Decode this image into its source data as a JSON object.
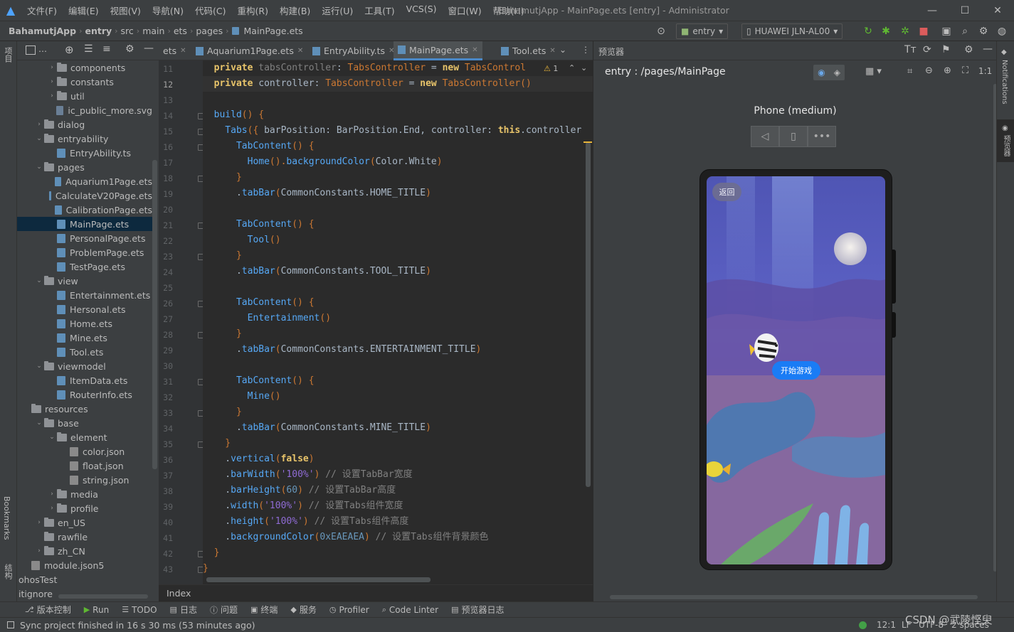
{
  "menubar": {
    "items": [
      "文件(F)",
      "编辑(E)",
      "视图(V)",
      "导航(N)",
      "代码(C)",
      "重构(R)",
      "构建(B)",
      "运行(U)",
      "工具(T)",
      "VCS(S)",
      "窗口(W)",
      "帮助(H)"
    ],
    "window_title": "BahamutjApp - MainPage.ets [entry] - Administrator"
  },
  "breadcrumb": [
    "BahamutjApp",
    "entry",
    "src",
    "main",
    "ets",
    "pages",
    "MainPage.ets"
  ],
  "toolbar": {
    "module": "entry",
    "device": "HUAWEI JLN-AL00"
  },
  "left_strip": {
    "project": "项目",
    "bookmarks": "Bookmarks",
    "structure": "结构"
  },
  "right_strip": {
    "notifications": "Notifications",
    "previewer": "预览器"
  },
  "project_tree": [
    {
      "label": "components",
      "type": "folder",
      "depth": 2,
      "arrow": "›"
    },
    {
      "label": "constants",
      "type": "folder",
      "depth": 2,
      "arrow": "›"
    },
    {
      "label": "util",
      "type": "folder",
      "depth": 2,
      "arrow": "›"
    },
    {
      "label": "ic_public_more.svg",
      "type": "svg",
      "depth": 2,
      "arrow": ""
    },
    {
      "label": "dialog",
      "type": "folder",
      "depth": 1,
      "arrow": "›"
    },
    {
      "label": "entryability",
      "type": "folder",
      "depth": 1,
      "arrow": "⌄"
    },
    {
      "label": "EntryAbility.ts",
      "type": "file",
      "depth": 2,
      "arrow": ""
    },
    {
      "label": "pages",
      "type": "folder",
      "depth": 1,
      "arrow": "⌄"
    },
    {
      "label": "Aquarium1Page.ets",
      "type": "file",
      "depth": 2,
      "arrow": ""
    },
    {
      "label": "CalculateV20Page.ets",
      "type": "file",
      "depth": 2,
      "arrow": ""
    },
    {
      "label": "CalibrationPage.ets",
      "type": "file",
      "depth": 2,
      "arrow": ""
    },
    {
      "label": "MainPage.ets",
      "type": "file",
      "depth": 2,
      "arrow": "",
      "selected": true
    },
    {
      "label": "PersonalPage.ets",
      "type": "file",
      "depth": 2,
      "arrow": ""
    },
    {
      "label": "ProblemPage.ets",
      "type": "file",
      "depth": 2,
      "arrow": ""
    },
    {
      "label": "TestPage.ets",
      "type": "file",
      "depth": 2,
      "arrow": ""
    },
    {
      "label": "view",
      "type": "folder",
      "depth": 1,
      "arrow": "⌄"
    },
    {
      "label": "Entertainment.ets",
      "type": "file",
      "depth": 2,
      "arrow": ""
    },
    {
      "label": "Hersonal.ets",
      "type": "file",
      "depth": 2,
      "arrow": ""
    },
    {
      "label": "Home.ets",
      "type": "file",
      "depth": 2,
      "arrow": ""
    },
    {
      "label": "Mine.ets",
      "type": "file",
      "depth": 2,
      "arrow": ""
    },
    {
      "label": "Tool.ets",
      "type": "file",
      "depth": 2,
      "arrow": ""
    },
    {
      "label": "viewmodel",
      "type": "folder",
      "depth": 1,
      "arrow": "⌄"
    },
    {
      "label": "ItemData.ets",
      "type": "file",
      "depth": 2,
      "arrow": ""
    },
    {
      "label": "RouterInfo.ets",
      "type": "file",
      "depth": 2,
      "arrow": ""
    },
    {
      "label": "resources",
      "type": "folder",
      "depth": 0,
      "arrow": ""
    },
    {
      "label": "base",
      "type": "folder",
      "depth": 1,
      "arrow": "⌄"
    },
    {
      "label": "element",
      "type": "folder",
      "depth": 2,
      "arrow": "⌄"
    },
    {
      "label": "color.json",
      "type": "json",
      "depth": 3,
      "arrow": ""
    },
    {
      "label": "float.json",
      "type": "json",
      "depth": 3,
      "arrow": ""
    },
    {
      "label": "string.json",
      "type": "json",
      "depth": 3,
      "arrow": ""
    },
    {
      "label": "media",
      "type": "folder",
      "depth": 2,
      "arrow": "›"
    },
    {
      "label": "profile",
      "type": "folder",
      "depth": 2,
      "arrow": "›"
    },
    {
      "label": "en_US",
      "type": "folder",
      "depth": 1,
      "arrow": "›"
    },
    {
      "label": "rawfile",
      "type": "folder",
      "depth": 1,
      "arrow": ""
    },
    {
      "label": "zh_CN",
      "type": "folder",
      "depth": 1,
      "arrow": "›"
    },
    {
      "label": "module.json5",
      "type": "json",
      "depth": 0,
      "arrow": ""
    },
    {
      "label": "ohosTest",
      "type": "plain",
      "depth": -1,
      "arrow": ""
    },
    {
      "label": "itignore",
      "type": "plain",
      "depth": -1,
      "arrow": ""
    }
  ],
  "editor_tabs": [
    {
      "label": "ets"
    },
    {
      "label": "Aquarium1Page.ets"
    },
    {
      "label": "EntryAbility.ts"
    },
    {
      "label": "MainPage.ets",
      "active": true
    },
    {
      "label": "Tool.ets"
    }
  ],
  "editor": {
    "line_numbers": [
      "11",
      "12",
      "13",
      "14",
      "15",
      "16",
      "17",
      "18",
      "19",
      "20",
      "21",
      "22",
      "23",
      "24",
      "25",
      "26",
      "27",
      "28",
      "29",
      "30",
      "31",
      "32",
      "33",
      "34",
      "35",
      "36",
      "37",
      "38",
      "39",
      "40",
      "41",
      "42",
      "43"
    ],
    "warning_count": "1",
    "footer_label": "Index",
    "lines": [
      [
        {
          "t": "  private ",
          "c": "kwy"
        },
        {
          "t": "tabsController",
          "c": "cm"
        },
        {
          "t": ": ",
          "c": "pl"
        },
        {
          "t": "TabsController",
          "c": "ty"
        },
        {
          "t": " = ",
          "c": "pl"
        },
        {
          "t": "new ",
          "c": "kwy"
        },
        {
          "t": "TabsControl",
          "c": "ty"
        }
      ],
      [
        {
          "t": "  private ",
          "c": "kwy"
        },
        {
          "t": "controller",
          "c": "pl"
        },
        {
          "t": ": ",
          "c": "pl"
        },
        {
          "t": "TabsController",
          "c": "ty"
        },
        {
          "t": " = ",
          "c": "pl"
        },
        {
          "t": "new ",
          "c": "kwy"
        },
        {
          "t": "TabsController",
          "c": "ty"
        },
        {
          "t": "()",
          "c": "ty"
        }
      ],
      [],
      [
        {
          "t": "  build",
          "c": "fn"
        },
        {
          "t": "() {",
          "c": "ty"
        }
      ],
      [
        {
          "t": "    Tabs",
          "c": "fn"
        },
        {
          "t": "({ ",
          "c": "ty"
        },
        {
          "t": "barPosition",
          "c": "pl"
        },
        {
          "t": ": BarPosition.End, ",
          "c": "pl"
        },
        {
          "t": "controller",
          "c": "pl"
        },
        {
          "t": ": ",
          "c": "pl"
        },
        {
          "t": "this",
          "c": "kwy"
        },
        {
          "t": ".controller",
          "c": "pl"
        }
      ],
      [
        {
          "t": "      TabContent",
          "c": "fn"
        },
        {
          "t": "() {",
          "c": "ty"
        }
      ],
      [
        {
          "t": "        Home",
          "c": "fn"
        },
        {
          "t": "().",
          "c": "ty"
        },
        {
          "t": "backgroundColor",
          "c": "fn"
        },
        {
          "t": "(",
          "c": "ty"
        },
        {
          "t": "Color.White",
          "c": "pl"
        },
        {
          "t": ")",
          "c": "ty"
        }
      ],
      [
        {
          "t": "      }",
          "c": "ty"
        }
      ],
      [
        {
          "t": "      .",
          "c": "pl"
        },
        {
          "t": "tabBar",
          "c": "fn"
        },
        {
          "t": "(",
          "c": "ty"
        },
        {
          "t": "CommonConstants.HOME_TITLE",
          "c": "pl"
        },
        {
          "t": ")",
          "c": "ty"
        }
      ],
      [],
      [
        {
          "t": "      TabContent",
          "c": "fn"
        },
        {
          "t": "() {",
          "c": "ty"
        }
      ],
      [
        {
          "t": "        Tool",
          "c": "fn"
        },
        {
          "t": "()",
          "c": "ty"
        }
      ],
      [
        {
          "t": "      }",
          "c": "ty"
        }
      ],
      [
        {
          "t": "      .",
          "c": "pl"
        },
        {
          "t": "tabBar",
          "c": "fn"
        },
        {
          "t": "(",
          "c": "ty"
        },
        {
          "t": "CommonConstants.TOOL_TITLE",
          "c": "pl"
        },
        {
          "t": ")",
          "c": "ty"
        }
      ],
      [],
      [
        {
          "t": "      TabContent",
          "c": "fn"
        },
        {
          "t": "() {",
          "c": "ty"
        }
      ],
      [
        {
          "t": "        Entertainment",
          "c": "fn"
        },
        {
          "t": "()",
          "c": "ty"
        }
      ],
      [
        {
          "t": "      }",
          "c": "ty"
        }
      ],
      [
        {
          "t": "      .",
          "c": "pl"
        },
        {
          "t": "tabBar",
          "c": "fn"
        },
        {
          "t": "(",
          "c": "ty"
        },
        {
          "t": "CommonConstants.ENTERTAINMENT_TITLE",
          "c": "pl"
        },
        {
          "t": ")",
          "c": "ty"
        }
      ],
      [],
      [
        {
          "t": "      TabContent",
          "c": "fn"
        },
        {
          "t": "() {",
          "c": "ty"
        }
      ],
      [
        {
          "t": "        Mine",
          "c": "fn"
        },
        {
          "t": "()",
          "c": "ty"
        }
      ],
      [
        {
          "t": "      }",
          "c": "ty"
        }
      ],
      [
        {
          "t": "      .",
          "c": "pl"
        },
        {
          "t": "tabBar",
          "c": "fn"
        },
        {
          "t": "(",
          "c": "ty"
        },
        {
          "t": "CommonConstants.MINE_TITLE",
          "c": "pl"
        },
        {
          "t": ")",
          "c": "ty"
        }
      ],
      [
        {
          "t": "    }",
          "c": "ty"
        }
      ],
      [
        {
          "t": "    .",
          "c": "pl"
        },
        {
          "t": "vertical",
          "c": "fn"
        },
        {
          "t": "(",
          "c": "ty"
        },
        {
          "t": "false",
          "c": "kwy"
        },
        {
          "t": ")",
          "c": "ty"
        }
      ],
      [
        {
          "t": "    .",
          "c": "pl"
        },
        {
          "t": "barWidth",
          "c": "fn"
        },
        {
          "t": "(",
          "c": "ty"
        },
        {
          "t": "'100%'",
          "c": "str"
        },
        {
          "t": ") ",
          "c": "ty"
        },
        {
          "t": "// 设置TabBar宽度",
          "c": "cm"
        }
      ],
      [
        {
          "t": "    .",
          "c": "pl"
        },
        {
          "t": "barHeight",
          "c": "fn"
        },
        {
          "t": "(",
          "c": "ty"
        },
        {
          "t": "60",
          "c": "num"
        },
        {
          "t": ") ",
          "c": "ty"
        },
        {
          "t": "// 设置TabBar高度",
          "c": "cm"
        }
      ],
      [
        {
          "t": "    .",
          "c": "pl"
        },
        {
          "t": "width",
          "c": "fn"
        },
        {
          "t": "(",
          "c": "ty"
        },
        {
          "t": "'100%'",
          "c": "str"
        },
        {
          "t": ") ",
          "c": "ty"
        },
        {
          "t": "// 设置Tabs组件宽度",
          "c": "cm"
        }
      ],
      [
        {
          "t": "    .",
          "c": "pl"
        },
        {
          "t": "height",
          "c": "fn"
        },
        {
          "t": "(",
          "c": "ty"
        },
        {
          "t": "'100%'",
          "c": "str"
        },
        {
          "t": ") ",
          "c": "ty"
        },
        {
          "t": "// 设置Tabs组件高度",
          "c": "cm"
        }
      ],
      [
        {
          "t": "    .",
          "c": "pl"
        },
        {
          "t": "backgroundColor",
          "c": "fn"
        },
        {
          "t": "(",
          "c": "ty"
        },
        {
          "t": "0xEAEAEA",
          "c": "num"
        },
        {
          "t": ") ",
          "c": "ty"
        },
        {
          "t": "// 设置Tabs组件背景颜色",
          "c": "cm"
        }
      ],
      [
        {
          "t": "  }",
          "c": "ty"
        }
      ],
      [
        {
          "t": "}",
          "c": "ty"
        }
      ]
    ]
  },
  "preview": {
    "title": "预览器",
    "route": "entry : /pages/MainPage",
    "device_name": "Phone (medium)",
    "phone": {
      "back_label": "返回",
      "start_game_label": "开始游戏"
    }
  },
  "bottom_tools": [
    "版本控制",
    "Run",
    "TODO",
    "日志",
    "问题",
    "终端",
    "服务",
    "Profiler",
    "Code Linter",
    "预览器日志"
  ],
  "status": {
    "message": "Sync project finished in 16 s 30 ms (53 minutes ago)",
    "position": "12:1",
    "line_sep": "LF",
    "encoding": "UTF-8",
    "indent": "2 spaces",
    "watermark": "CSDN @武陵悭臾"
  },
  "colors": {
    "accent": "#4a88c7",
    "selection": "#0d293e",
    "start_button": "#1a7cf5"
  }
}
